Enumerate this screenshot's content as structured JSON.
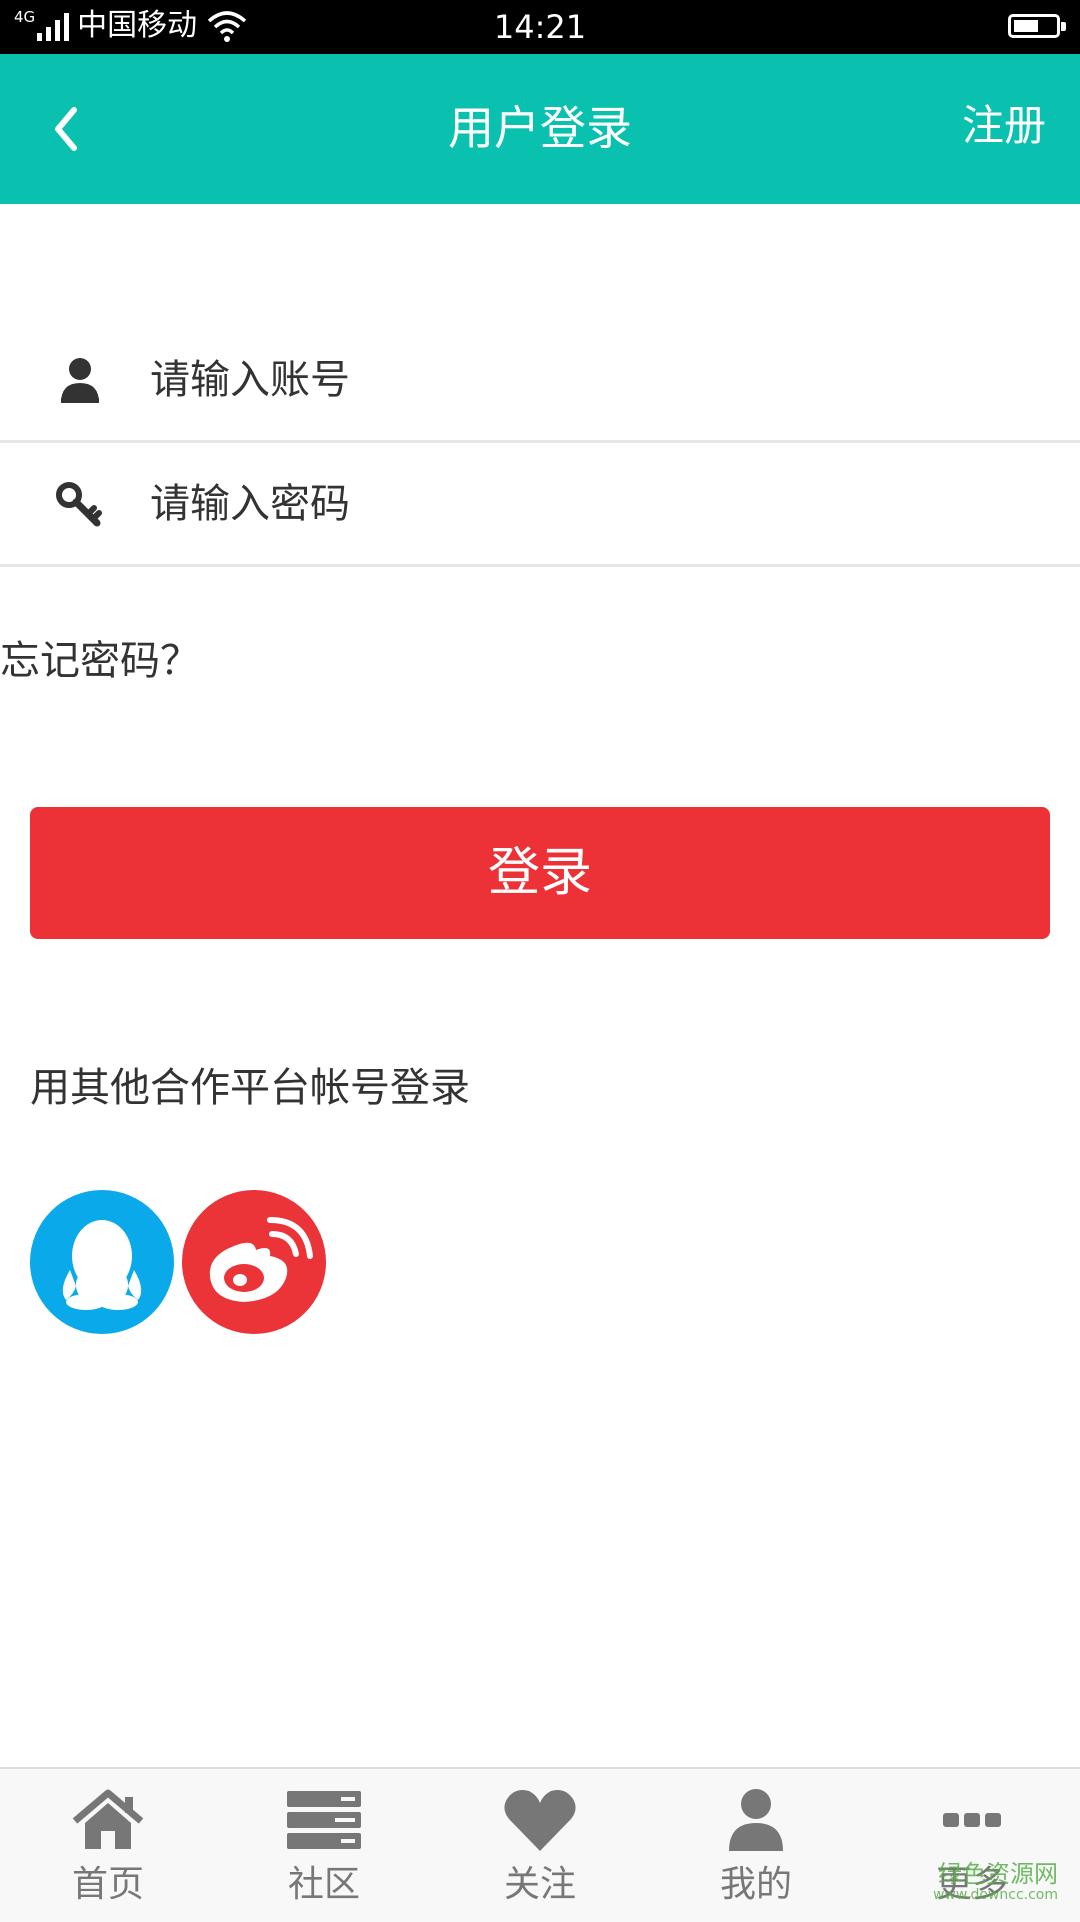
{
  "status_bar": {
    "network": "4G",
    "carrier": "中国移动",
    "time": "14:21",
    "battery_level": 0.5
  },
  "header": {
    "title": "用户登录",
    "register_label": "注册",
    "background_color": "#09c1ae"
  },
  "form": {
    "account_placeholder": "请输入账号",
    "account_value": "",
    "password_placeholder": "请输入密码",
    "password_value": "",
    "forgot_label": "忘记密码？",
    "login_label": "登录",
    "login_color": "#ec3236"
  },
  "third_party": {
    "title": "用其他合作平台帐号登录",
    "providers": [
      {
        "icon": "qq-icon",
        "color": "#0aa9ea"
      },
      {
        "icon": "weibo-icon",
        "color": "#ea3437"
      }
    ]
  },
  "tabbar": {
    "items": [
      {
        "label": "首页",
        "icon": "home-icon"
      },
      {
        "label": "社区",
        "icon": "community-icon"
      },
      {
        "label": "关注",
        "icon": "heart-icon"
      },
      {
        "label": "我的",
        "icon": "user-icon"
      },
      {
        "label": "更多",
        "icon": "more-icon"
      }
    ]
  },
  "watermark": {
    "main": "绿色资源网",
    "sub": "www.downcc.com"
  }
}
